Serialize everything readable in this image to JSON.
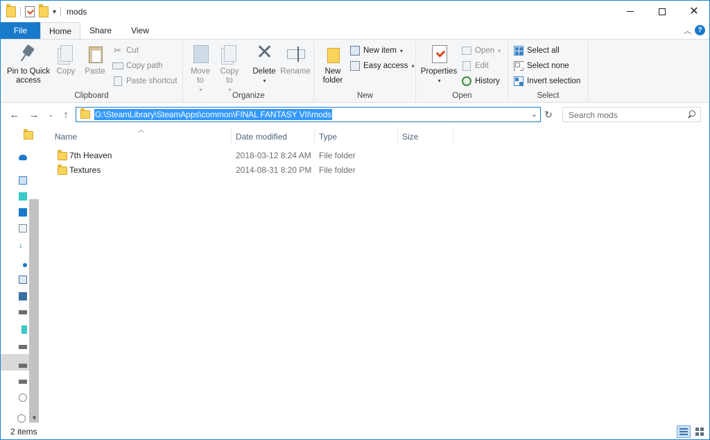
{
  "window": {
    "title": "mods",
    "qat_dropdown": "▾",
    "minimize": "",
    "maximize": "",
    "close": "✕"
  },
  "tabs": {
    "file": "File",
    "home": "Home",
    "share": "Share",
    "view": "View",
    "collapse": "︿",
    "help": "?"
  },
  "ribbon": {
    "clipboard": {
      "label": "Clipboard",
      "pin": "Pin to Quick access",
      "copy": "Copy",
      "paste": "Paste",
      "cut": "Cut",
      "copy_path": "Copy path",
      "paste_shortcut": "Paste shortcut"
    },
    "organize": {
      "label": "Organize",
      "move_to": "Move to",
      "copy_to": "Copy to",
      "delete": "Delete",
      "rename": "Rename"
    },
    "new": {
      "label": "New",
      "new_folder": "New folder",
      "new_item": "New item",
      "easy_access": "Easy access"
    },
    "open": {
      "label": "Open",
      "properties": "Properties",
      "open": "Open",
      "edit": "Edit",
      "history": "History"
    },
    "select": {
      "label": "Select",
      "select_all": "Select all",
      "select_none": "Select none",
      "invert_selection": "Invert selection"
    }
  },
  "navigation": {
    "back": "←",
    "forward": "→",
    "recent": "⌄",
    "up": "↑",
    "address": "G:\\SteamLibrary\\SteamApps\\common\\FINAL FANTASY VII\\mods",
    "address_dropdown": "⌄",
    "refresh": "↻",
    "search_placeholder": "Search mods"
  },
  "columns": {
    "name": "Name",
    "date_modified": "Date modified",
    "type": "Type",
    "size": "Size"
  },
  "files": [
    {
      "name": "7th Heaven",
      "date": "2018-03-12 8:24 AM",
      "type": "File folder"
    },
    {
      "name": "Textures",
      "date": "2014-08-31 8:20 PM",
      "type": "File folder"
    }
  ],
  "status": {
    "count": "2 items"
  },
  "colors": {
    "accent": "#1979ca",
    "selection": "#3399ff",
    "folder": "#f9d45c"
  }
}
